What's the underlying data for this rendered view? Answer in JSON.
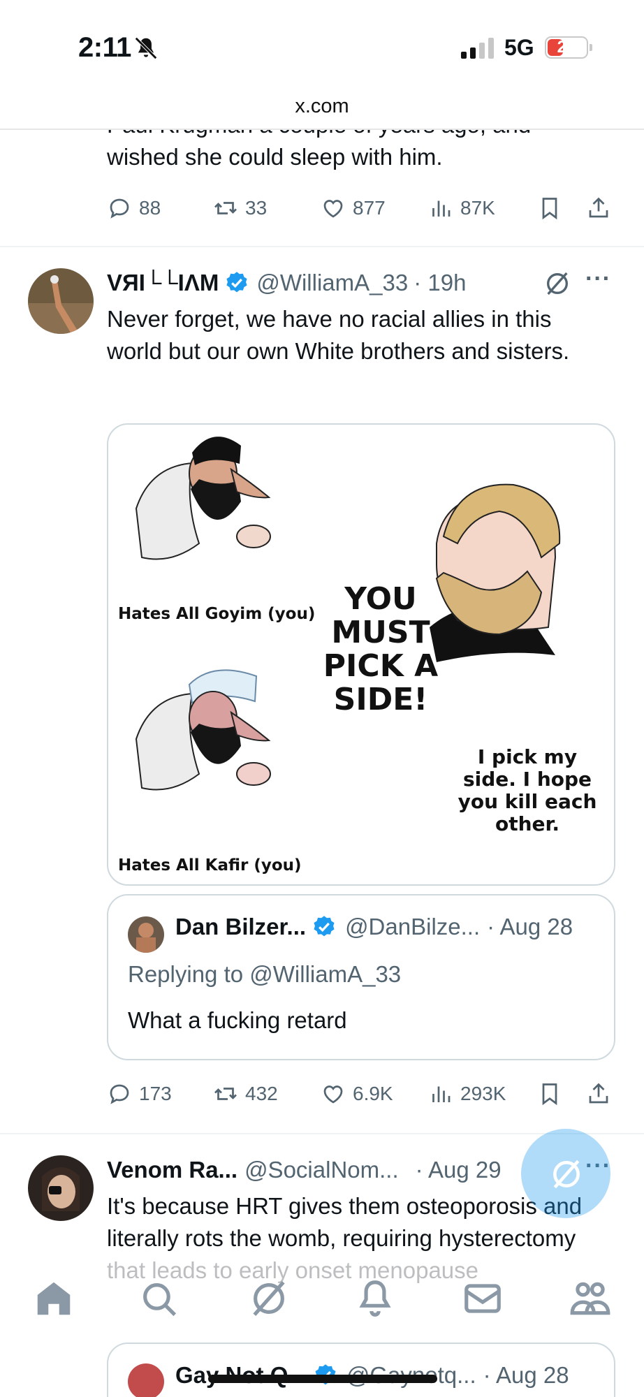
{
  "status_bar": {
    "time": "2:11",
    "network": "5G",
    "battery": "20"
  },
  "browser": {
    "url": "x.com"
  },
  "prev_tweet": {
    "text_partial": "Paul Krugman a couple of years ago, and",
    "text_last_line": "wished she could sleep with him.",
    "replies": "88",
    "reposts": "33",
    "likes": "877",
    "views": "87K"
  },
  "tweet": {
    "name": "VЯI└└IΛM",
    "handle": "@WilliamA_33",
    "time": "· 19h",
    "text": "Never forget, we have no racial allies in this world but our own White brothers and sisters.",
    "media": {
      "label_top_left": "Hates All Goyim (you)",
      "label_bottom_left": "Hates All Kafir (you)",
      "center_text": "YOU MUST PICK A SIDE!",
      "right_text": "I pick my side. I hope you kill each other."
    },
    "quote": {
      "name": "Dan Bilzer...",
      "handle": "@DanBilze...",
      "time": "· Aug 28",
      "reply_prefix": "Replying to ",
      "reply_to": "@WilliamA_33",
      "text": "What a fucking retard"
    },
    "replies": "173",
    "reposts": "432",
    "likes": "6.9K",
    "views": "293K"
  },
  "next_tweet": {
    "name": "Venom Ra...",
    "handle": "@SocialNom...",
    "time": "· Aug 29",
    "text": "It's because HRT gives them osteoporosis and literally rots the womb, requiring hysterectomy that leads to early onset menopause",
    "quote": {
      "name": "Gay Not Q...",
      "handle": "@Gaynotq...",
      "time": "· Aug 28"
    }
  },
  "colors": {
    "accent": "#1d9bf0",
    "text": "#0f1419",
    "muted": "#536471",
    "border": "#cfd9de"
  },
  "icons": {
    "reply": "speech-bubble-icon",
    "repost": "repost-icon",
    "like": "heart-icon",
    "views": "bar-chart-icon",
    "bookmark": "bookmark-icon",
    "share": "share-icon",
    "grok": "grok-icon",
    "more": "more-icon",
    "nav": [
      "home-icon",
      "search-icon",
      "grok-icon",
      "notifications-icon",
      "messages-icon",
      "communities-icon"
    ]
  }
}
